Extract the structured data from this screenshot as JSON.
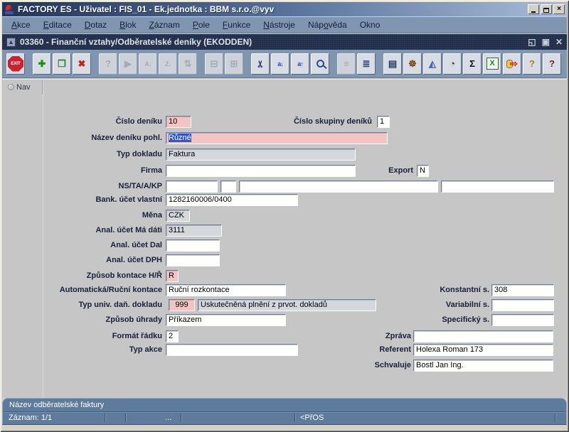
{
  "window": {
    "title": "FACTORY ES - Uživatel : FIS_01 - Ek.jednotka : BBM s.r.o.@vyv",
    "close_glyph": "×"
  },
  "menu": {
    "items": [
      {
        "pre": "",
        "key": "A",
        "post": "kce"
      },
      {
        "pre": "",
        "key": "E",
        "post": "ditace"
      },
      {
        "pre": "",
        "key": "D",
        "post": "otaz"
      },
      {
        "pre": "",
        "key": "B",
        "post": "lok"
      },
      {
        "pre": "",
        "key": "Z",
        "post": "áznam"
      },
      {
        "pre": "",
        "key": "P",
        "post": "ole"
      },
      {
        "pre": "",
        "key": "F",
        "post": "unkce"
      },
      {
        "pre": "",
        "key": "N",
        "post": "ástroje"
      },
      {
        "pre": "Náp",
        "key": "o",
        "post": "věda"
      },
      {
        "pre": "Okno",
        "key": "",
        "post": ""
      }
    ]
  },
  "mdi": {
    "title": "03360 - Finanční vztahy/Odběratelské deníky (EKODDEN)",
    "icon_glyph": "▲",
    "controls": {
      "min": "◱",
      "restore": "▣",
      "close": "✕"
    }
  },
  "toolbar": {
    "buttons": [
      {
        "name": "exit",
        "glyph": "EXIT",
        "enabled": true
      },
      {
        "name": "insert-record",
        "glyph": "✚",
        "enabled": true
      },
      {
        "name": "duplicate-record",
        "glyph": "❐",
        "enabled": true
      },
      {
        "name": "delete-record",
        "glyph": "✖",
        "enabled": true
      },
      {
        "name": "enter-query",
        "glyph": "?",
        "enabled": false
      },
      {
        "name": "execute-query",
        "glyph": "▶",
        "enabled": false
      },
      {
        "name": "sort-ascending",
        "glyph": "A↓",
        "enabled": false
      },
      {
        "name": "sort-descending",
        "glyph": "Z↓",
        "enabled": false
      },
      {
        "name": "sort-multi",
        "glyph": "⇅",
        "enabled": false
      },
      {
        "name": "print",
        "glyph": "⊟",
        "enabled": false
      },
      {
        "name": "print-batch",
        "glyph": "⊞",
        "enabled": false
      },
      {
        "name": "cut",
        "glyph": "✂",
        "enabled": true
      },
      {
        "name": "copy",
        "glyph": "a↓",
        "enabled": true
      },
      {
        "name": "paste",
        "glyph": "a↑",
        "enabled": true
      },
      {
        "name": "find",
        "glyph": "",
        "enabled": true
      },
      {
        "name": "list-of-values",
        "glyph": "≡",
        "enabled": false
      },
      {
        "name": "list-records",
        "glyph": "≣",
        "enabled": true
      },
      {
        "name": "clipboard-document",
        "glyph": "▤",
        "enabled": true
      },
      {
        "name": "ship-wheel",
        "glyph": "☸",
        "enabled": true
      },
      {
        "name": "prism",
        "glyph": "◭",
        "enabled": true
      },
      {
        "name": "clock",
        "glyph": "◔",
        "enabled": true
      },
      {
        "name": "sum",
        "glyph": "Σ",
        "enabled": true
      },
      {
        "name": "excel-export",
        "glyph": "X",
        "enabled": true
      },
      {
        "name": "data-export",
        "glyph": "⇨",
        "enabled": true
      },
      {
        "name": "user-help",
        "glyph": "?",
        "enabled": true
      },
      {
        "name": "help",
        "glyph": "?",
        "enabled": true
      }
    ]
  },
  "canvas": {
    "nav_tab": "Nav"
  },
  "form": {
    "fields": {
      "cislo_deniku": {
        "label": "Číslo deníku",
        "value": "10"
      },
      "cislo_skupiny_deniku": {
        "label": "Číslo skupiny deníků",
        "value": "1"
      },
      "nazev_deniku_pohl": {
        "label": "Název deníku pohl.",
        "value": "Různé"
      },
      "typ_dokladu": {
        "label": "Typ dokladu",
        "value": "Faktura"
      },
      "firma": {
        "label": "Firma",
        "value": ""
      },
      "export": {
        "label": "Export",
        "value": "N"
      },
      "ns_ta_a_kp": {
        "label": "NS/TA/A/KP",
        "value1": "",
        "value2": "",
        "value3": "",
        "value4": ""
      },
      "bank_ucet_vlastni": {
        "label": "Bank. účet vlastní",
        "value": "1282160006/0400"
      },
      "mena": {
        "label": "Měna",
        "value": "CZK"
      },
      "anal_ucet_ma_dati": {
        "label": "Anal. účet Má dáti",
        "value": "3111"
      },
      "anal_ucet_dal": {
        "label": "Anal. účet Dal",
        "value": ""
      },
      "anal_ucet_dph": {
        "label": "Anal. účet DPH",
        "value": ""
      },
      "zpusob_kontace": {
        "label": "Způsob kontace H/Ř",
        "value": "R"
      },
      "automaticka_rucni_kontace": {
        "label": "Automatická/Ruční kontace",
        "value": "Ruční rozkontace"
      },
      "typ_univ_dan_dokladu": {
        "label": "Typ univ. daň. dokladu",
        "value": "999",
        "description": "Uskutečněná plnění z prvot. dokladů"
      },
      "zpusob_uhrady": {
        "label": "Způsob úhrady",
        "value": "Příkazem"
      },
      "format_radku": {
        "label": "Formát řádku",
        "value": "2"
      },
      "typ_akce": {
        "label": "Typ akce",
        "value": ""
      },
      "konstantni_s": {
        "label": "Konstantní s.",
        "value": "308"
      },
      "variabilni_s": {
        "label": "Variabilní s.",
        "value": ""
      },
      "specificky_s": {
        "label": "Specifický s.",
        "value": ""
      },
      "zprava": {
        "label": "Zpráva",
        "value": ""
      },
      "referent": {
        "label": "Referent",
        "value": "Holexa Roman 173"
      },
      "schvaluje": {
        "label": "Schvaluje",
        "value": "Bostl Jan Ing."
      }
    }
  },
  "status": {
    "hint": "Název odběratelské faktury",
    "record": "Záznam: 1/1",
    "dots": "...",
    "mode": "<PřOS"
  },
  "colors": {
    "field_required_pink": "#f2c4c4",
    "field_disabled_gray": "#d4d7dc",
    "selection_blue": "#3355cc",
    "statusbar_blue": "#5e7a9c",
    "titlebar_dark": "#22355b",
    "titlebar_light": "#a9bdd9",
    "menubar": "#8095af"
  }
}
